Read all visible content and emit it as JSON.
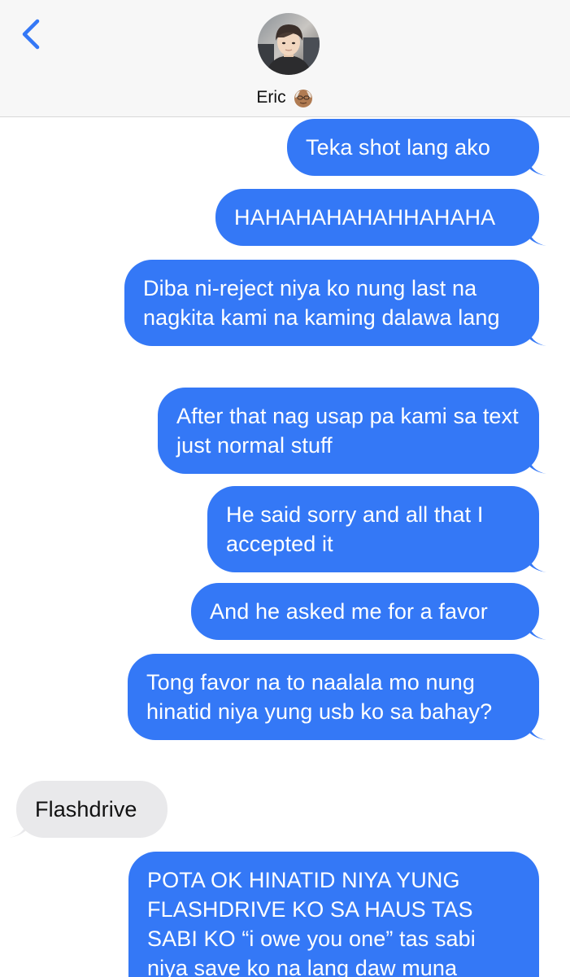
{
  "header": {
    "contact_name": "Eric",
    "contact_emoji": "old-man-emoji",
    "back_icon": "chevron-left-icon",
    "accent": "#3478f6"
  },
  "messages": [
    {
      "direction": "sent",
      "text": "Teka shot lang ako"
    },
    {
      "direction": "sent",
      "text": "HAHAHAHAHAHHAHAHA"
    },
    {
      "direction": "sent",
      "text": "Diba ni-reject niya ko nung last na nagkita kami na kaming dalawa lang"
    },
    {
      "direction": "sent",
      "text": "After that nag usap pa kami sa text just normal stuff"
    },
    {
      "direction": "sent",
      "text": "He said sorry and all that I accepted it"
    },
    {
      "direction": "sent",
      "text": "And he asked me for a favor"
    },
    {
      "direction": "sent",
      "text": "Tong favor na to naalala mo nung hinatid niya yung usb ko sa bahay?"
    },
    {
      "direction": "received",
      "text": "Flashdrive"
    },
    {
      "direction": "sent",
      "text": "POTA OK HINATID NIYA YUNG FLASHDRIVE KO SA HAUS TAS SABI KO “i owe you one” tas sabi niya save ko na lang daw muna"
    }
  ],
  "colors": {
    "sent_bubble": "#3478f6",
    "received_bubble": "#e9e9eb",
    "header_bg": "#f7f7f7"
  }
}
